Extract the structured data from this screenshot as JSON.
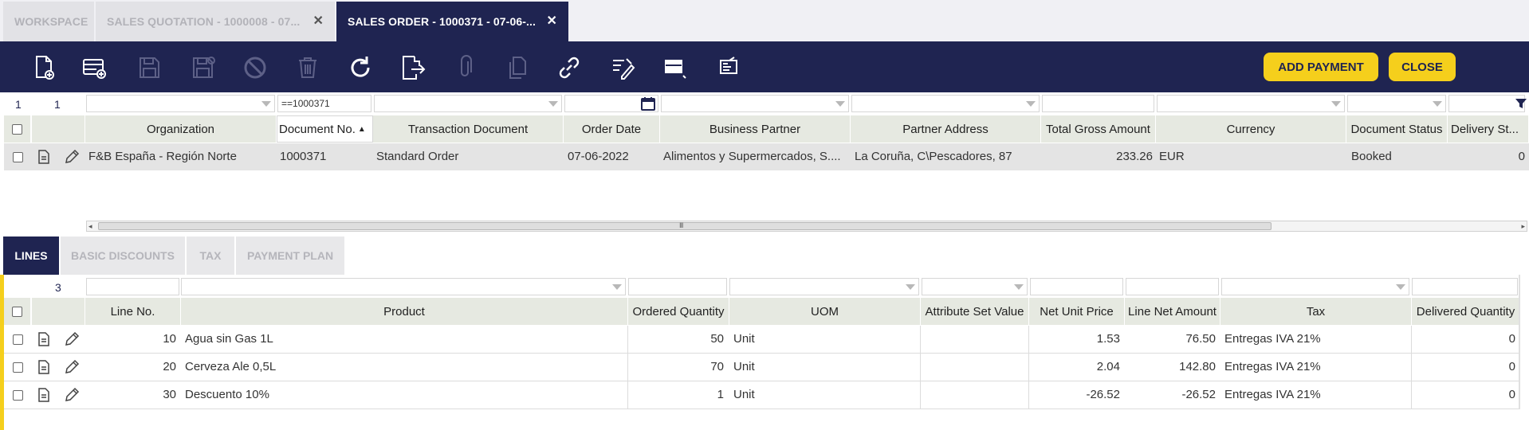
{
  "tabs": [
    {
      "label": "WORKSPACE",
      "active": false,
      "closable": false
    },
    {
      "label": "SALES QUOTATION - 1000008 - 07...",
      "active": false,
      "closable": true
    },
    {
      "label": "SALES ORDER - 1000371 - 07-06-...",
      "active": true,
      "closable": true
    }
  ],
  "toolbar": {
    "icons": [
      "new-document-icon",
      "new-record-icon",
      "save-icon",
      "save-close-icon",
      "undo-icon",
      "delete-icon",
      "refresh-icon",
      "export-icon",
      "attachment-icon",
      "copy-record-icon",
      "link-icon",
      "process-icon",
      "grid-view-icon",
      "report-icon"
    ],
    "add_payment_label": "ADD PAYMENT",
    "close_label": "CLOSE"
  },
  "header_grid": {
    "page_number": "1",
    "row_count": "1",
    "document_filter": "==1000371",
    "columns": [
      "Organization",
      "Document No.",
      "Transaction Document",
      "Order Date",
      "Business Partner",
      "Partner Address",
      "Total Gross Amount",
      "Currency",
      "Document Status",
      "Delivery St..."
    ],
    "rows": [
      {
        "organization": "F&B España - Región Norte",
        "document_no": "1000371",
        "transaction_document": "Standard Order",
        "order_date": "07-06-2022",
        "business_partner": "Alimentos y Supermercados, S....",
        "partner_address": "La Coruña, C\\Pescadores, 87",
        "total_gross_amount": "233.26",
        "currency": "EUR",
        "document_status": "Booked",
        "delivery_status": "0"
      }
    ],
    "scroll_grip": "III"
  },
  "subtabs": [
    {
      "label": "LINES",
      "active": true
    },
    {
      "label": "BASIC DISCOUNTS",
      "active": false
    },
    {
      "label": "TAX",
      "active": false
    },
    {
      "label": "PAYMENT PLAN",
      "active": false
    }
  ],
  "lines_grid": {
    "row_count": "3",
    "columns": [
      "Line No.",
      "Product",
      "Ordered Quantity",
      "UOM",
      "Attribute Set Value",
      "Net Unit Price",
      "Line Net Amount",
      "Tax",
      "Delivered Quantity"
    ],
    "rows": [
      {
        "line_no": "10",
        "product": "Agua sin Gas 1L",
        "ordered_quantity": "50",
        "uom": "Unit",
        "attribute_set_value": "",
        "net_unit_price": "1.53",
        "line_net_amount": "76.50",
        "tax": "Entregas IVA 21%",
        "delivered_quantity": "0"
      },
      {
        "line_no": "20",
        "product": "Cerveza Ale 0,5L",
        "ordered_quantity": "70",
        "uom": "Unit",
        "attribute_set_value": "",
        "net_unit_price": "2.04",
        "line_net_amount": "142.80",
        "tax": "Entregas IVA 21%",
        "delivered_quantity": "0"
      },
      {
        "line_no": "30",
        "product": "Descuento 10%",
        "ordered_quantity": "1",
        "uom": "Unit",
        "attribute_set_value": "",
        "net_unit_price": "-26.52",
        "line_net_amount": "-26.52",
        "tax": "Entregas IVA 21%",
        "delivered_quantity": "0"
      }
    ]
  },
  "colors": {
    "navy": "#1f2451",
    "accent_yellow": "#f5cf1c",
    "header_bg": "#e6e9e1"
  }
}
